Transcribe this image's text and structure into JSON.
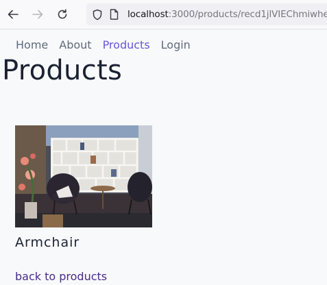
{
  "browser": {
    "url_host": "localhost",
    "url_rest": ":3000/products/recd1jlVIEChmiwhe"
  },
  "nav": {
    "items": [
      {
        "label": "Home"
      },
      {
        "label": "About"
      },
      {
        "label": "Products",
        "active": true
      },
      {
        "label": "Login"
      }
    ]
  },
  "page": {
    "title": "Products"
  },
  "product": {
    "name": "Armchair",
    "image_icon": "room-photo"
  },
  "footer": {
    "back_link": "back to products"
  },
  "colors": {
    "active_nav": "#6a55d8",
    "nav": "#5f6b7d",
    "link": "#4a2b88",
    "background": "#f8f9fb"
  }
}
